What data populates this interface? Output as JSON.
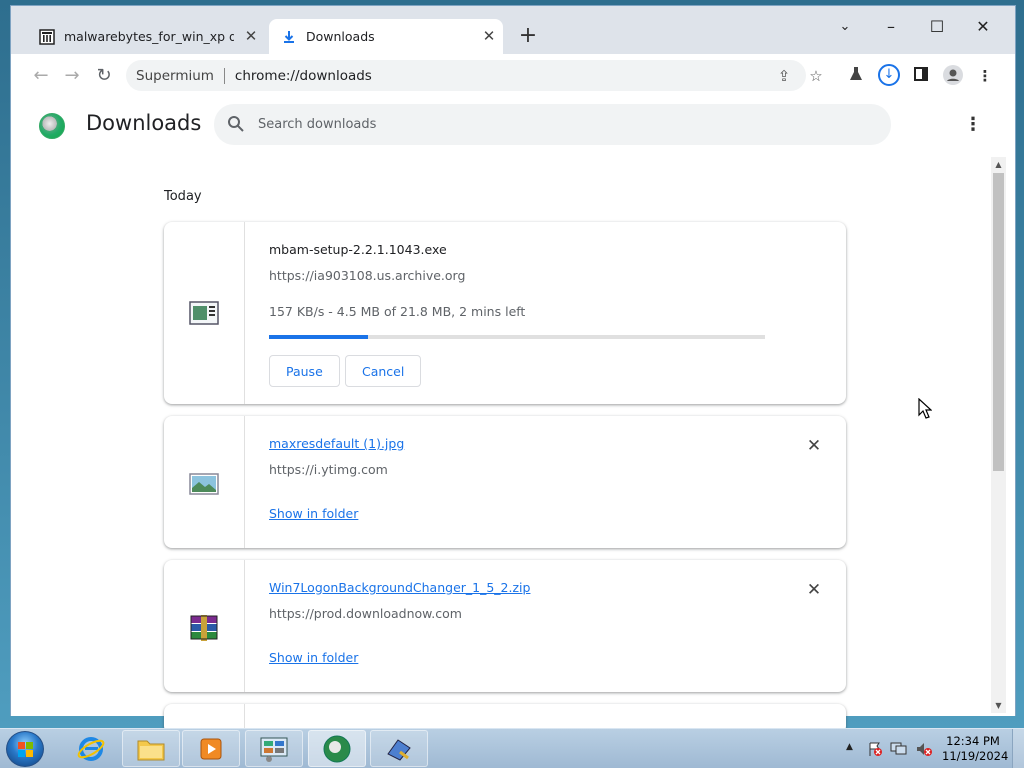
{
  "browser": {
    "tabs": [
      {
        "title": "malwarebytes_for_win_xp directory",
        "icon": "archive-icon"
      },
      {
        "title": "Downloads",
        "icon": "download-icon"
      }
    ],
    "new_tab_label": "+",
    "omnibox": {
      "brand": "Supermium",
      "url": "chrome://downloads"
    }
  },
  "page": {
    "title": "Downloads",
    "search_placeholder": "Search downloads",
    "section_label": "Today",
    "downloads": [
      {
        "filename": "mbam-setup-2.2.1.1043.exe",
        "source": "https://ia903108.us.archive.org",
        "status": "157 KB/s - 4.5 MB of 21.8 MB, 2 mins left",
        "progress_fraction": 0.2,
        "pause_label": "Pause",
        "cancel_label": "Cancel",
        "icon": "installer-icon"
      },
      {
        "filename": "maxresdefault (1).jpg",
        "source": "https://i.ytimg.com",
        "action_label": "Show in folder",
        "icon": "image-file-icon"
      },
      {
        "filename": "Win7LogonBackgroundChanger_1_5_2.zip",
        "source": "https://prod.downloadnow.com",
        "action_label": "Show in folder",
        "icon": "winrar-archive-icon"
      }
    ]
  },
  "taskbar": {
    "clock_time": "12:34 PM",
    "clock_date": "11/19/2024"
  },
  "colors": {
    "accent": "#1a73e8",
    "tab_strip": "#dee3ea",
    "taskbar": "#a9c3dc"
  }
}
